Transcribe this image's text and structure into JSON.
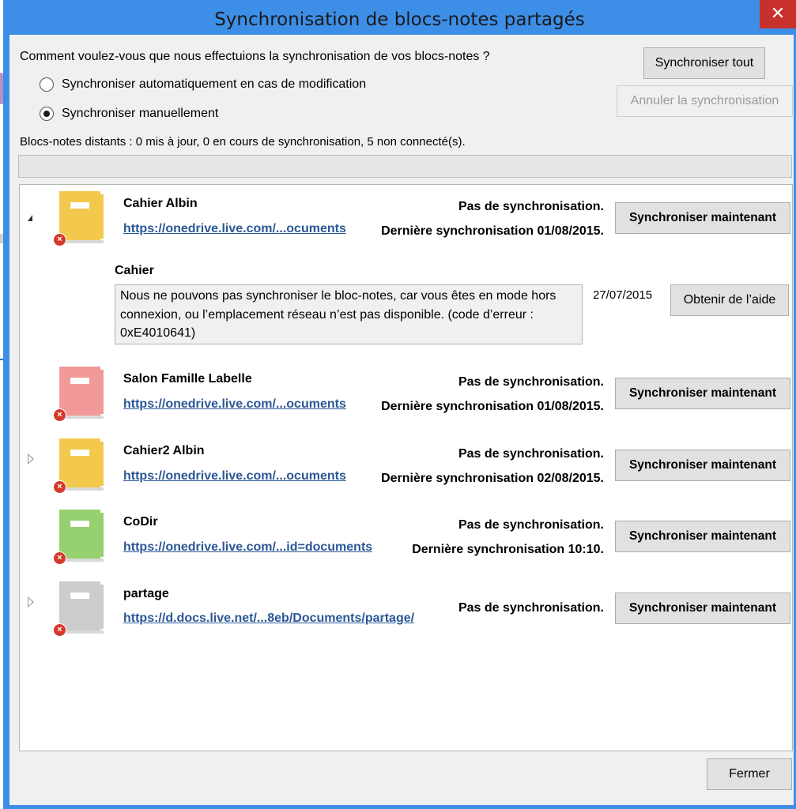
{
  "window": {
    "title": "Synchronisation de blocs-notes partagés",
    "close_glyph": "✕"
  },
  "question": "Comment voulez-vous que nous effectuions la synchronisation de vos blocs-notes ?",
  "options": [
    {
      "label": "Synchroniser automatiquement en cas de modification",
      "checked": false
    },
    {
      "label": "Synchroniser manuellement",
      "checked": true
    }
  ],
  "buttons": {
    "sync_all": "Synchroniser tout",
    "cancel_sync": "Annuler la synchronisation",
    "close": "Fermer",
    "sync_now": "Synchroniser maintenant",
    "help": "Obtenir de l’aide"
  },
  "status": "Blocs-notes distants : 0 mis à jour, 0 en cours de synchronisation, 5 non connecté(s).",
  "notebooks": [
    {
      "name": "Cahier Albin",
      "url": "https://onedrive.live.com/...ocuments",
      "status": "Pas de synchronisation.",
      "last_sync": "Dernière synchronisation 01/08/2015.",
      "color": "#f2c94c",
      "expander": "open",
      "error": {
        "section": "Cahier",
        "message": "Nous ne pouvons pas synchroniser le bloc-notes, car vous êtes en mode hors connexion, ou l’emplacement réseau n’est pas disponible. (code d’erreur : 0xE4010641)",
        "date": "27/07/2015"
      }
    },
    {
      "name": "Salon Famille Labelle",
      "url": "https://onedrive.live.com/...ocuments",
      "status": "Pas de synchronisation.",
      "last_sync": "Dernière synchronisation 01/08/2015.",
      "color": "#f29a9a",
      "expander": "none"
    },
    {
      "name": "Cahier2 Albin",
      "url": "https://onedrive.live.com/...ocuments",
      "status": "Pas de synchronisation.",
      "last_sync": "Dernière synchronisation 02/08/2015.",
      "color": "#f2c94c",
      "expander": "closed"
    },
    {
      "name": "CoDir",
      "url": "https://onedrive.live.com/...id=documents",
      "status": "Pas de synchronisation.",
      "last_sync": "Dernière synchronisation 10:10.",
      "color": "#95d16e",
      "expander": "none"
    },
    {
      "name": "partage",
      "url": "https://d.docs.live.net/...8eb/Documents/partage/",
      "status": "Pas de synchronisation.",
      "last_sync": "",
      "color": "#cccccc",
      "expander": "closed"
    }
  ],
  "icons": {
    "error_badge": "×",
    "notebook": "notebook-icon"
  }
}
